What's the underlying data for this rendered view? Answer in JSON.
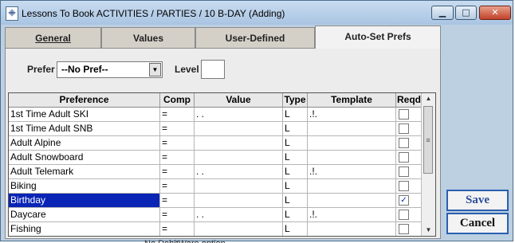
{
  "window": {
    "title": "Lessons To Book  ACTIVITIES / PARTIES / 10 B-DAY (Adding)",
    "app_icon_glyph": "ꔰ",
    "minimize_glyph": "▁",
    "maximize_glyph": "□",
    "close_glyph": "✕"
  },
  "tabs": [
    {
      "label": "General",
      "active": false
    },
    {
      "label": "Values",
      "active": false
    },
    {
      "label": "User-Defined",
      "active": false
    },
    {
      "label": "Auto-Set Prefs",
      "active": true
    }
  ],
  "filters": {
    "prefer_label": "Prefer",
    "prefer_value": "--No Pref--",
    "level_label": "Level",
    "level_value": ""
  },
  "grid": {
    "columns": [
      "Preference",
      "Comp",
      "Value",
      "Type",
      "Template",
      "Reqd"
    ],
    "rows": [
      {
        "preference": "1st Time Adult SKI",
        "comp": "=",
        "value": ". .",
        "type": "L",
        "template": ".!.",
        "reqd": false,
        "selected": false
      },
      {
        "preference": "1st Time Adult SNB",
        "comp": "=",
        "value": "",
        "type": "L",
        "template": "",
        "reqd": false,
        "selected": false
      },
      {
        "preference": "Adult Alpine",
        "comp": "=",
        "value": "",
        "type": "L",
        "template": "",
        "reqd": false,
        "selected": false
      },
      {
        "preference": "Adult Snowboard",
        "comp": "=",
        "value": "",
        "type": "L",
        "template": "",
        "reqd": false,
        "selected": false
      },
      {
        "preference": "Adult Telemark",
        "comp": "=",
        "value": ". .",
        "type": "L",
        "template": ".!.",
        "reqd": false,
        "selected": false
      },
      {
        "preference": "Biking",
        "comp": "=",
        "value": "",
        "type": "L",
        "template": "",
        "reqd": false,
        "selected": false
      },
      {
        "preference": "Birthday",
        "comp": "=",
        "value": "",
        "type": "L",
        "template": "",
        "reqd": true,
        "selected": true
      },
      {
        "preference": "Daycare",
        "comp": "=",
        "value": ". .",
        "type": "L",
        "template": ".!.",
        "reqd": false,
        "selected": false
      },
      {
        "preference": "Fishing",
        "comp": "=",
        "value": "",
        "type": "L",
        "template": "",
        "reqd": false,
        "selected": false
      }
    ]
  },
  "actions": {
    "save_label": "Save",
    "cancel_label": "Cancel"
  },
  "status": {
    "partial_text": "No DebitWare option"
  }
}
